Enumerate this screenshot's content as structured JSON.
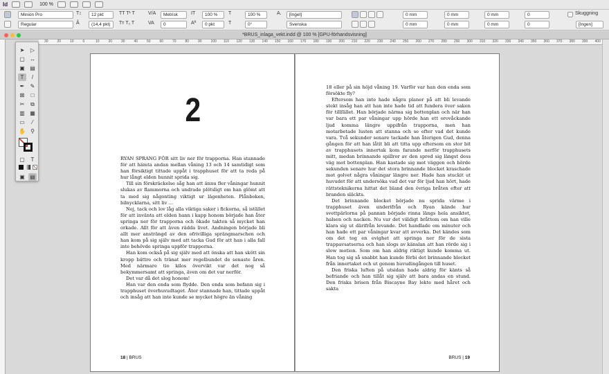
{
  "app": {
    "logo": "Id",
    "zoom": "100 %"
  },
  "control": {
    "font_family": "Minion Pro",
    "font_style": "Regular",
    "font_size": "12 pkt",
    "leading": "(14,4 pkt)",
    "kerning": "Metrisk",
    "tracking": "0",
    "scale_v": "100 %",
    "scale_h": "100 %",
    "baseline": "0 pkt",
    "skew": "0°",
    "char_style": "[Inget]",
    "language": "Svenska",
    "indent_left": "0 mm",
    "indent_right": "0 mm",
    "space_before": "0 mm",
    "space_after": "0 mm",
    "first_indent": "0 mm",
    "last_indent": "0 mm",
    "drop_lines": "0",
    "drop_chars": "0",
    "shading_label": "Skuggning",
    "para_style": "[Ingen]"
  },
  "document": {
    "tab_title": "*BRUS_inlaga_vekt.indd @ 100 % [GPU-förhandsvisning]"
  },
  "ruler_ticks": [
    "30",
    "20",
    "10",
    "0",
    "10",
    "20",
    "30",
    "40",
    "50",
    "60",
    "70",
    "80",
    "90",
    "100",
    "110",
    "120",
    "130",
    "140",
    "150",
    "160",
    "170",
    "180",
    "190",
    "200",
    "210",
    "220",
    "230",
    "240",
    "250",
    "260",
    "270",
    "280",
    "290",
    "300",
    "310",
    "320",
    "330",
    "340",
    "350",
    "360",
    "370",
    "380",
    "390",
    "400"
  ],
  "left_page": {
    "chapter_number": "2",
    "folio_number": "18",
    "folio_text": "| BRUS",
    "paragraphs": [
      {
        "cls": "first",
        "text": "RYAN SPRANG FÖR sitt liv ner för trapporna. Han stannade för att hämta andan mellan våning 13 och 14 samtidigt som han försiktigt tittade uppåt i trapphuset för att ta reda på hur långt elden hunnit sprida sig."
      },
      {
        "cls": "",
        "text": "Till sin förskräckelse såg han att ännu fler våningar hunnit slukas av flammorna och undrade plötsligt om han glömt att ta med sig någonting viktigt ur lägenheten. Plånboken, bilnycklarna, sitt liv …"
      },
      {
        "cls": "",
        "text": "Nej, tack och lov låg alla viktiga saker i fickorna, så istället för att invänta att elden hann i kapp honom började han åter springa ner för trapporna och ökade takten så mycket han orkade. Allt för att även rädda livet. Andningen började bli allt mer ansträngd av den ofrivilliga sprängmarschen och han kom på sig själv med att tacka Gud för att han i alla fall inte behövde springa uppför trapporna."
      },
      {
        "cls": "",
        "text": "Han kom också på sig själv med att önska att han skött sin kropp bättre och tränat mer regelbundet de senaste åren. Med närmare tio kilos övervikt var det nog så bekymmersamt att springa, även om det var nerför."
      },
      {
        "cls": "",
        "text": "Det var då det slog honom!"
      },
      {
        "cls": "",
        "text": "Han var den enda som flydde. Den enda som befann sig i trapphuset överhuvudtaget. Åter stannade han, tittade uppåt och insåg att han inte kunde se mycket högre än våning"
      }
    ]
  },
  "right_page": {
    "folio_number": "19",
    "folio_text": "BRUS |",
    "paragraphs": [
      {
        "cls": "cont",
        "text": "18 eller på sin höjd våning 19. Varför var han den enda som försökte fly?"
      },
      {
        "cls": "",
        "text": "Eftersom han inte hade några planer på att bli levande stekt insåg han att han inte hade tid att fundera över saken för tillfället. Han började närma sig bottenplan och när han var bara ett par våningar upp hörde han ett orovåckande ljud komma längre uppifrån trapporna, men han motarbetade lusten att stanna och se efter vad det kunde vara. Två sekunder senare tackade han återigen Gud, denna gången för att han låtit bli att titta upp eftersom en stor bit av trapphusets innertak kom farande nerför trapphusets mitt, medan brinnande spillror av den spred sig längst dess väg mot bottenplan. Han kastade sig mot väggen och hörde sekunden senare hur det stora brinnande blocket kraschade mot golvet några våningar längre ner. Hade han stuckit ut huvudet för att undersöka vad det var för ljud han hört, hade rättsteknikerna hittat det bland den övriga bråten efter att branden släckts."
      },
      {
        "cls": "",
        "text": "Det brinnande blocket började nu sprida värme i trapphuset även underifrån och Ryan kände hur svettpärlorna på pannan började rinna längs hela ansiktet, halsen och nacken. Nu var det väldigt bråttom om han ville klara sig ut därifrån levande. Det handlade om minuter och han hade ett par våningar kvar att avverka. Det kändes som om det tog en evighet att springa ner för de sista trappavsatserna och han slogs av känslan att han rörde sig i slow motion. Som om han aldrig riktigt kunde komma ut. Han tog sig så snabbt han kunde förbi det brinnande blocket från innertaket och ut genom huvudingången till huset."
      },
      {
        "cls": "",
        "text": "Den friska luften på utsidan hade aldrig för känts så befriande och han tillåt sig själv att bara andas en stund. Den friska brisen från Biscayne Bay lekte med håret och sakta"
      }
    ]
  },
  "colors": {
    "accent_close": "#fe5f57",
    "accent_min": "#febc2e",
    "accent_max": "#28c840"
  }
}
